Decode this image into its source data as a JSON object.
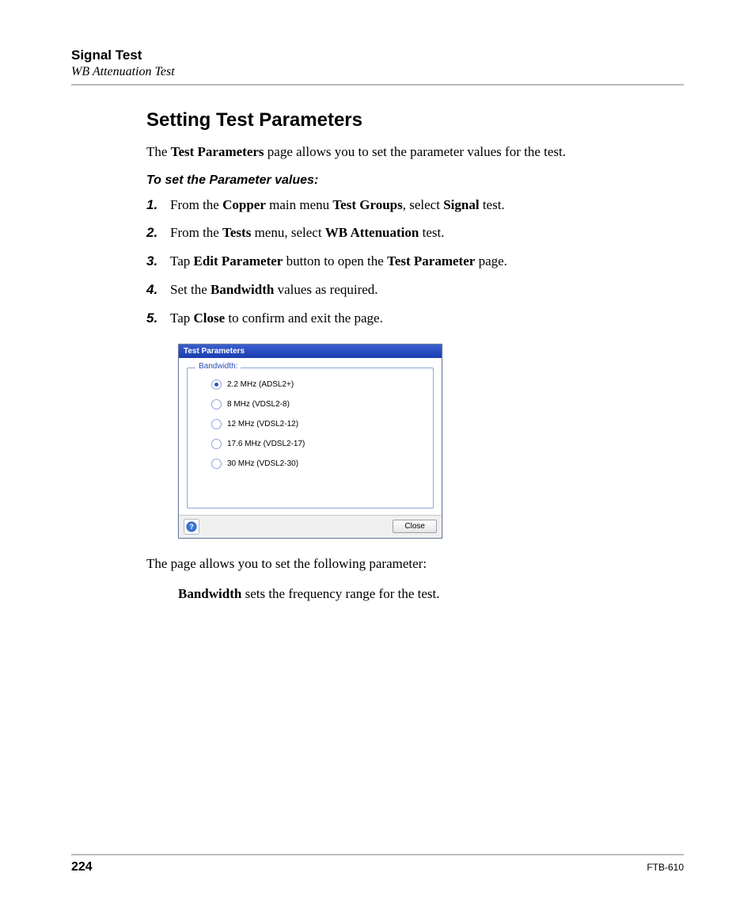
{
  "header": {
    "chapter": "Signal Test",
    "subsection": "WB Attenuation Test"
  },
  "section_title": "Setting Test Parameters",
  "intro": {
    "pre": "The ",
    "bold": "Test Parameters",
    "post": " page allows you to set the parameter values for the test."
  },
  "subhead": "To set the Parameter values:",
  "steps": [
    {
      "n": "1.",
      "parts": [
        "From the ",
        "Copper",
        " main menu ",
        "Test Groups",
        ", select ",
        "Signal",
        " test."
      ]
    },
    {
      "n": "2.",
      "parts": [
        "From the ",
        "Tests",
        " menu, select ",
        "WB Attenuation",
        " test."
      ]
    },
    {
      "n": "3.",
      "parts": [
        "Tap ",
        "Edit Parameter",
        " button to open the ",
        "Test Parameter",
        " page."
      ]
    },
    {
      "n": "4.",
      "parts": [
        "Set the ",
        "Bandwidth",
        " values as required."
      ]
    },
    {
      "n": "5.",
      "parts": [
        "Tap ",
        "Close",
        " to confirm and exit the page."
      ]
    }
  ],
  "screenshot": {
    "title": "Test Parameters",
    "group_label": "Bandwidth:",
    "options": [
      {
        "label": "2.2 MHz (ADSL2+)",
        "selected": true
      },
      {
        "label": "8 MHz (VDSL2-8)",
        "selected": false
      },
      {
        "label": "12 MHz (VDSL2-12)",
        "selected": false
      },
      {
        "label": "17.6 MHz (VDSL2-17)",
        "selected": false
      },
      {
        "label": "30 MHz (VDSL2-30)",
        "selected": false
      }
    ],
    "close_label": "Close"
  },
  "outro1": "The page allows you to set the following parameter:",
  "outro2": {
    "bold": "Bandwidth",
    "post": " sets the frequency range for the test."
  },
  "footer": {
    "page": "224",
    "model": "FTB-610"
  }
}
